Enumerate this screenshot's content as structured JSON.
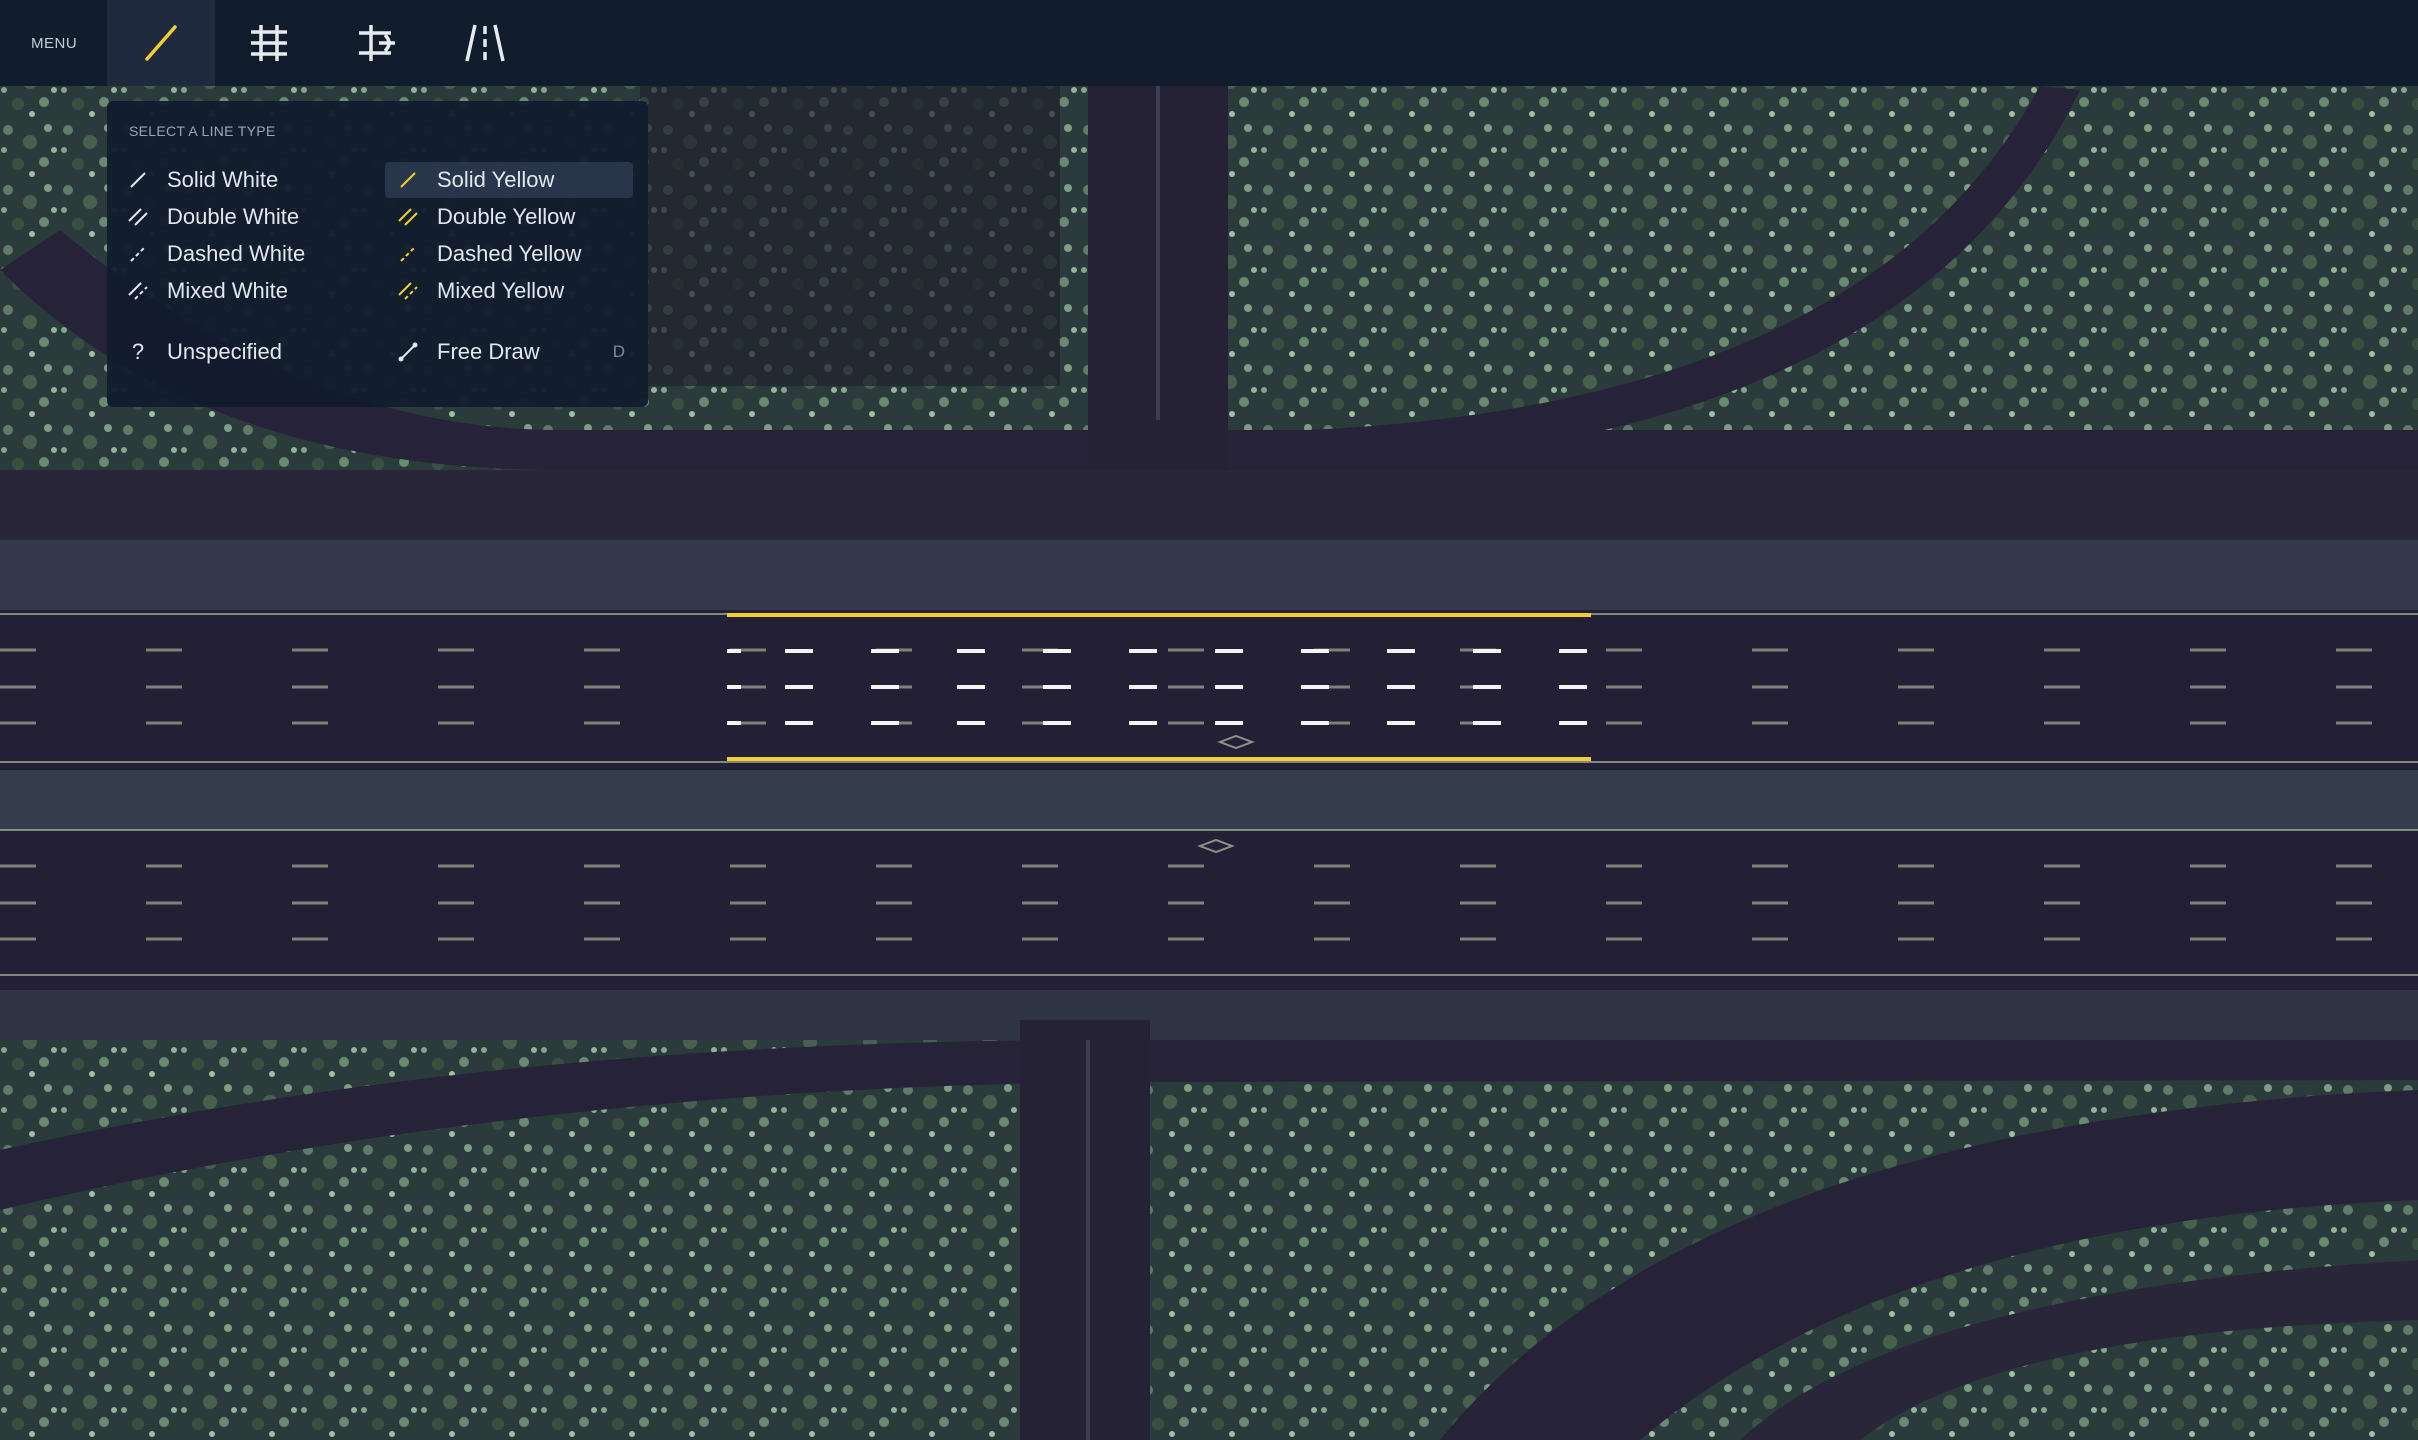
{
  "toolbar": {
    "menu_label": "MENU",
    "tools": [
      {
        "name": "line-tool",
        "icon": "slash-line-icon",
        "active": true
      },
      {
        "name": "grid-tool",
        "icon": "hash-grid-icon",
        "active": false
      },
      {
        "name": "split-tool",
        "icon": "split-arrow-icon",
        "active": false
      },
      {
        "name": "lane-tool",
        "icon": "lane-lines-icon",
        "active": false
      }
    ]
  },
  "line_type_panel": {
    "title": "SELECT A LINE TYPE",
    "options": {
      "solid_white": "Solid White",
      "double_white": "Double White",
      "dashed_white": "Dashed White",
      "mixed_white": "Mixed White",
      "solid_yellow": "Solid Yellow",
      "double_yellow": "Double Yellow",
      "dashed_yellow": "Dashed Yellow",
      "mixed_yellow": "Mixed Yellow",
      "unspecified": "Unspecified",
      "unspecified_icon": "?",
      "free_draw": "Free Draw",
      "free_draw_shortcut": "D"
    },
    "selected": "Solid Yellow"
  },
  "colors": {
    "toolbar_bg": "#111c2d",
    "accent_yellow": "#f1cf2e",
    "lane_white": "#f4f4f4",
    "asphalt": "#231f35",
    "vegetation": "#5e7a68"
  }
}
